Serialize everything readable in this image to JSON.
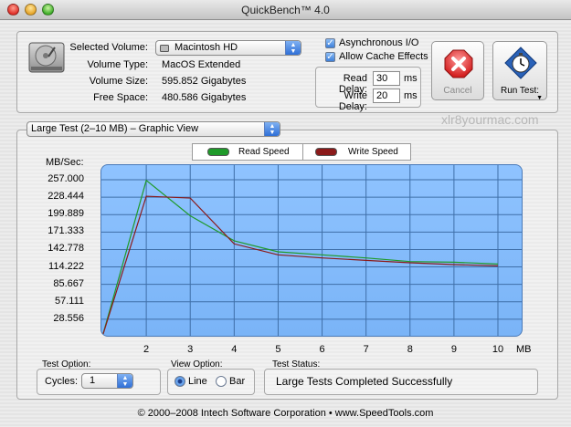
{
  "window": {
    "title": "QuickBench™ 4.0"
  },
  "volume": {
    "selected_label": "Selected Volume:",
    "selected_value": "Macintosh HD",
    "type_label": "Volume Type:",
    "type_value": "MacOS Extended",
    "size_label": "Volume Size:",
    "size_value": "595.852 Gigabytes",
    "free_label": "Free Space:",
    "free_value": "480.586 Gigabytes"
  },
  "options": {
    "async_label": "Asynchronous I/O",
    "async_checked": true,
    "cache_label": "Allow Cache Effects",
    "cache_checked": true,
    "read_delay_label": "Read Delay:",
    "read_delay_value": "30",
    "read_delay_unit": "ms",
    "write_delay_label": "Write Delay:",
    "write_delay_value": "20",
    "write_delay_unit": "ms"
  },
  "buttons": {
    "cancel_label": "Cancel",
    "run_test_label": "Run Test:"
  },
  "watermark": "xlr8yourmac.com",
  "test_select": {
    "value": "Large Test (2–10 MB) – Graphic View"
  },
  "legend": {
    "read_label": "Read Speed",
    "write_label": "Write Speed"
  },
  "colors": {
    "read": "#1f9a2a",
    "write": "#8b1a1a",
    "plot_bg": "#86bdfb",
    "grid": "#3f6fa8"
  },
  "chart_data": {
    "type": "line",
    "ylabel": "MB/Sec:",
    "xlabel": "MB",
    "x": [
      1,
      2,
      3,
      4,
      5,
      6,
      7,
      8,
      9,
      10
    ],
    "x_ticks": [
      "2",
      "3",
      "4",
      "5",
      "6",
      "7",
      "8",
      "9",
      "10"
    ],
    "y_ticks": [
      "257.000",
      "228.444",
      "199.889",
      "171.333",
      "142.778",
      "114.222",
      "85.667",
      "57.111",
      "28.556"
    ],
    "ylim": [
      0,
      257
    ],
    "xlim": [
      1,
      10
    ],
    "grid": true,
    "legend_position": "top",
    "series": [
      {
        "name": "Read Speed",
        "values": [
          0,
          256,
          198,
          157,
          139,
          134,
          129,
          123,
          122,
          119
        ]
      },
      {
        "name": "Write Speed",
        "values": [
          0,
          230,
          227,
          152,
          134,
          129,
          125,
          121,
          118,
          116
        ]
      }
    ]
  },
  "test_option": {
    "label": "Test Option:",
    "cycles_label": "Cycles:",
    "cycles_value": "1"
  },
  "view_option": {
    "label": "View Option:",
    "line_label": "Line",
    "bar_label": "Bar",
    "selected": "Line"
  },
  "status": {
    "label": "Test Status:",
    "value": "Large Tests Completed Successfully"
  },
  "footer": {
    "text": "© 2000–2008 Intech Software Corporation • www.SpeedTools.com"
  }
}
